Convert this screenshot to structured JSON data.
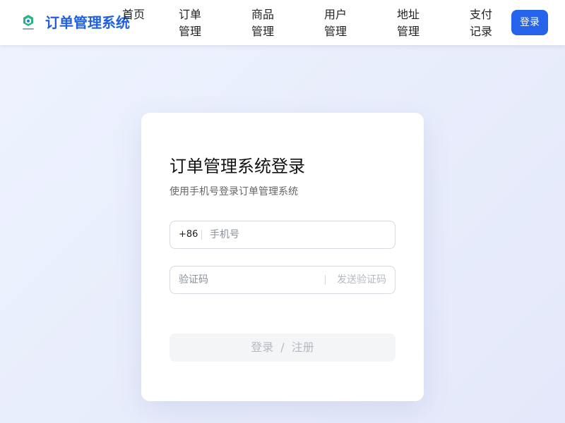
{
  "header": {
    "logo_icon": "brand-logo-icon",
    "brand": "订单管理系统",
    "nav": [
      "首页",
      "订单管理",
      "商品管理",
      "用户管理",
      "地址管理",
      "支付记录"
    ],
    "login_label": "登录",
    "accent": "#2563eb"
  },
  "login": {
    "title": "订单管理系统登录",
    "subtitle": "使用手机号登录订单管理系统",
    "phone_prefix": "+86",
    "phone_placeholder": "手机号",
    "code_placeholder": "验证码",
    "send_code_label": "发送验证码",
    "submit_login": "登录",
    "submit_sep": "/",
    "submit_register": "注册"
  }
}
